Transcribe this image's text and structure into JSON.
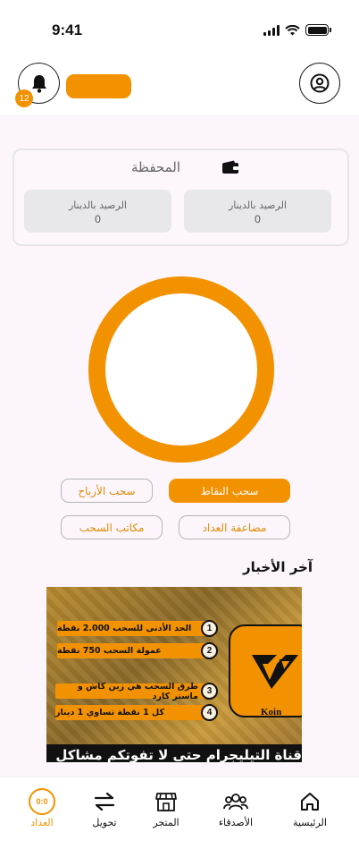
{
  "status_bar": {
    "time": "9:41"
  },
  "header": {
    "notification_count": "12",
    "accent": "#f39200"
  },
  "wallet": {
    "title": "المحفظة",
    "balances": [
      {
        "label": "الرصيد بالدينار",
        "value": "0"
      },
      {
        "label": "الرصيد بالدينار",
        "value": "0"
      }
    ]
  },
  "actions": {
    "withdraw_points": "سحب النقاط",
    "withdraw_profits": "سحب الأرباح",
    "double_counter": "مضاعفة العداد",
    "withdraw_offices": "مكاتب السحب"
  },
  "news": {
    "title": "آخر الأخبار",
    "image": {
      "features": [
        {
          "number": "1",
          "text": "الحد الأدنى للسحب 2.000 نقطة"
        },
        {
          "number": "2",
          "text": "عمولة السحب 750 نقطة"
        },
        {
          "number": "3",
          "text": "طرق السحب هي زين كاش و ماستر كارد"
        },
        {
          "number": "4",
          "text": "كل 1 نقطة تساوي 1 دينار"
        }
      ],
      "brand": "Koin",
      "caption": "قناة التيليجرام حتى لا تفوتكم مشاكل"
    }
  },
  "tabbar": {
    "home": "الرئيسية",
    "friends": "الأصدقاء",
    "store": "المتجر",
    "transfer": "تحويل",
    "counter": "العداد",
    "counter_icon_text": "0:0"
  }
}
